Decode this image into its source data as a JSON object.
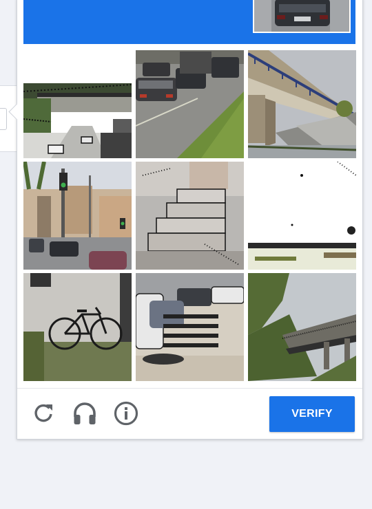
{
  "colors": {
    "accent": "#1a73e8",
    "icon_gray": "#5f6368"
  },
  "header": {
    "sample_image": "car-rear-photo"
  },
  "grid": {
    "tiles": [
      {
        "subject": "highway-overpass"
      },
      {
        "subject": "traffic-on-road"
      },
      {
        "subject": "bridge-underside"
      },
      {
        "subject": "street-with-traffic-light"
      },
      {
        "subject": "stairs"
      },
      {
        "subject": "overexposed-landscape"
      },
      {
        "subject": "bicycle-by-wall"
      },
      {
        "subject": "parked-cars-crosswalk"
      },
      {
        "subject": "overpass-through-trees"
      }
    ]
  },
  "footer": {
    "icons": [
      "reload-icon",
      "headphones-icon",
      "info-icon"
    ],
    "verify_label": "VERIFY"
  }
}
